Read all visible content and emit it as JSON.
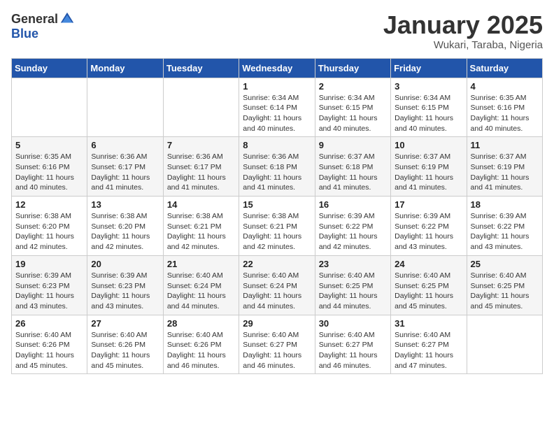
{
  "header": {
    "logo_general": "General",
    "logo_blue": "Blue",
    "month_title": "January 2025",
    "location": "Wukari, Taraba, Nigeria"
  },
  "days_of_week": [
    "Sunday",
    "Monday",
    "Tuesday",
    "Wednesday",
    "Thursday",
    "Friday",
    "Saturday"
  ],
  "weeks": [
    [
      {
        "day": "",
        "info": ""
      },
      {
        "day": "",
        "info": ""
      },
      {
        "day": "",
        "info": ""
      },
      {
        "day": "1",
        "info": "Sunrise: 6:34 AM\nSunset: 6:14 PM\nDaylight: 11 hours and 40 minutes."
      },
      {
        "day": "2",
        "info": "Sunrise: 6:34 AM\nSunset: 6:15 PM\nDaylight: 11 hours and 40 minutes."
      },
      {
        "day": "3",
        "info": "Sunrise: 6:34 AM\nSunset: 6:15 PM\nDaylight: 11 hours and 40 minutes."
      },
      {
        "day": "4",
        "info": "Sunrise: 6:35 AM\nSunset: 6:16 PM\nDaylight: 11 hours and 40 minutes."
      }
    ],
    [
      {
        "day": "5",
        "info": "Sunrise: 6:35 AM\nSunset: 6:16 PM\nDaylight: 11 hours and 40 minutes."
      },
      {
        "day": "6",
        "info": "Sunrise: 6:36 AM\nSunset: 6:17 PM\nDaylight: 11 hours and 41 minutes."
      },
      {
        "day": "7",
        "info": "Sunrise: 6:36 AM\nSunset: 6:17 PM\nDaylight: 11 hours and 41 minutes."
      },
      {
        "day": "8",
        "info": "Sunrise: 6:36 AM\nSunset: 6:18 PM\nDaylight: 11 hours and 41 minutes."
      },
      {
        "day": "9",
        "info": "Sunrise: 6:37 AM\nSunset: 6:18 PM\nDaylight: 11 hours and 41 minutes."
      },
      {
        "day": "10",
        "info": "Sunrise: 6:37 AM\nSunset: 6:19 PM\nDaylight: 11 hours and 41 minutes."
      },
      {
        "day": "11",
        "info": "Sunrise: 6:37 AM\nSunset: 6:19 PM\nDaylight: 11 hours and 41 minutes."
      }
    ],
    [
      {
        "day": "12",
        "info": "Sunrise: 6:38 AM\nSunset: 6:20 PM\nDaylight: 11 hours and 42 minutes."
      },
      {
        "day": "13",
        "info": "Sunrise: 6:38 AM\nSunset: 6:20 PM\nDaylight: 11 hours and 42 minutes."
      },
      {
        "day": "14",
        "info": "Sunrise: 6:38 AM\nSunset: 6:21 PM\nDaylight: 11 hours and 42 minutes."
      },
      {
        "day": "15",
        "info": "Sunrise: 6:38 AM\nSunset: 6:21 PM\nDaylight: 11 hours and 42 minutes."
      },
      {
        "day": "16",
        "info": "Sunrise: 6:39 AM\nSunset: 6:22 PM\nDaylight: 11 hours and 42 minutes."
      },
      {
        "day": "17",
        "info": "Sunrise: 6:39 AM\nSunset: 6:22 PM\nDaylight: 11 hours and 43 minutes."
      },
      {
        "day": "18",
        "info": "Sunrise: 6:39 AM\nSunset: 6:22 PM\nDaylight: 11 hours and 43 minutes."
      }
    ],
    [
      {
        "day": "19",
        "info": "Sunrise: 6:39 AM\nSunset: 6:23 PM\nDaylight: 11 hours and 43 minutes."
      },
      {
        "day": "20",
        "info": "Sunrise: 6:39 AM\nSunset: 6:23 PM\nDaylight: 11 hours and 43 minutes."
      },
      {
        "day": "21",
        "info": "Sunrise: 6:40 AM\nSunset: 6:24 PM\nDaylight: 11 hours and 44 minutes."
      },
      {
        "day": "22",
        "info": "Sunrise: 6:40 AM\nSunset: 6:24 PM\nDaylight: 11 hours and 44 minutes."
      },
      {
        "day": "23",
        "info": "Sunrise: 6:40 AM\nSunset: 6:25 PM\nDaylight: 11 hours and 44 minutes."
      },
      {
        "day": "24",
        "info": "Sunrise: 6:40 AM\nSunset: 6:25 PM\nDaylight: 11 hours and 45 minutes."
      },
      {
        "day": "25",
        "info": "Sunrise: 6:40 AM\nSunset: 6:25 PM\nDaylight: 11 hours and 45 minutes."
      }
    ],
    [
      {
        "day": "26",
        "info": "Sunrise: 6:40 AM\nSunset: 6:26 PM\nDaylight: 11 hours and 45 minutes."
      },
      {
        "day": "27",
        "info": "Sunrise: 6:40 AM\nSunset: 6:26 PM\nDaylight: 11 hours and 45 minutes."
      },
      {
        "day": "28",
        "info": "Sunrise: 6:40 AM\nSunset: 6:26 PM\nDaylight: 11 hours and 46 minutes."
      },
      {
        "day": "29",
        "info": "Sunrise: 6:40 AM\nSunset: 6:27 PM\nDaylight: 11 hours and 46 minutes."
      },
      {
        "day": "30",
        "info": "Sunrise: 6:40 AM\nSunset: 6:27 PM\nDaylight: 11 hours and 46 minutes."
      },
      {
        "day": "31",
        "info": "Sunrise: 6:40 AM\nSunset: 6:27 PM\nDaylight: 11 hours and 47 minutes."
      },
      {
        "day": "",
        "info": ""
      }
    ]
  ]
}
